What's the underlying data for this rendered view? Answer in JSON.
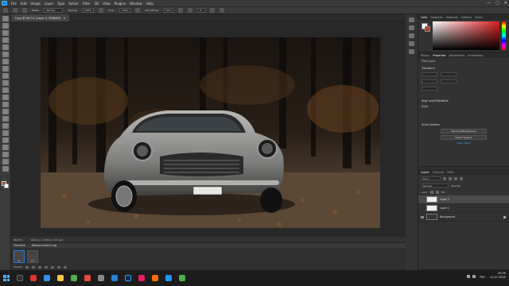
{
  "menubar": {
    "app_icon": "Ps",
    "items": [
      "File",
      "Edit",
      "Image",
      "Layer",
      "Type",
      "Select",
      "Filter",
      "3D",
      "View",
      "Plugins",
      "Window",
      "Help"
    ],
    "window_controls": [
      "—",
      "▢",
      "✕"
    ]
  },
  "options_bar": {
    "mode_label": "Mode:",
    "mode_value": "Normal",
    "opacity_label": "Opacity:",
    "opacity_value": "100%",
    "flow_label": "Flow:",
    "flow_value": "100%",
    "smoothing_label": "Smoothing:",
    "smoothing_value": "10%",
    "angle_value": "0°"
  },
  "document": {
    "tab_title": "1.jpg @ 66,7% (Layer 2, RGB/8#)",
    "close_icon": "×"
  },
  "status": {
    "zoom": "66,67%",
    "dimensions": "1920 px x 1080 px (72 ppi)"
  },
  "timeline": {
    "tabs": [
      "Timeline",
      "Measurement Log"
    ],
    "frames": [
      {
        "num": "1",
        "delay": "0,2"
      },
      {
        "num": "2",
        "delay": "0,2"
      }
    ],
    "loop_label": "Forever"
  },
  "color_panel": {
    "tabs": [
      "Color",
      "Swatches",
      "Gradients",
      "Patterns",
      "Styles"
    ],
    "active_tab": "Color",
    "foreground": "#b43a2a",
    "background": "#ffffff"
  },
  "properties_panel": {
    "tabs": [
      "History",
      "Properties",
      "Adjustments",
      "Annotations"
    ],
    "active_tab": "Properties",
    "layer_type": "Pixel Layer",
    "transform_header": "Transform",
    "align_header": "Align and Distribute",
    "align_label": "Align:",
    "quick_actions_header": "Quick Actions",
    "remove_bg_button": "Remove Background",
    "select_subject_button": "Select Subject",
    "learn_more_link": "Learn More"
  },
  "layers_panel": {
    "tabs": [
      "Layers",
      "Channels",
      "Paths"
    ],
    "active_tab": "Layers",
    "kind_label": "Kind",
    "blend_mode": "Normal",
    "opacity_label": "Opacity:",
    "lock_label": "Lock:",
    "fill_label": "Fill:",
    "layers": [
      {
        "name": "Layer 2",
        "visible": false,
        "selected": true,
        "thumb": "white"
      },
      {
        "name": "Layer 1",
        "visible": false,
        "selected": false,
        "thumb": "white"
      },
      {
        "name": "Background",
        "visible": true,
        "selected": false,
        "thumb": "image"
      }
    ]
  },
  "taskbar": {
    "language": "РУС",
    "time": "20:35",
    "date": "11.07.2021"
  }
}
